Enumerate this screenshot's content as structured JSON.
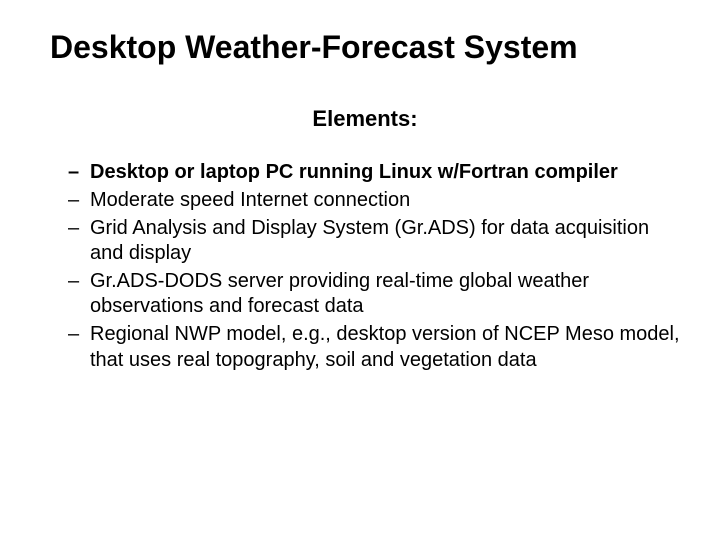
{
  "slide": {
    "title": "Desktop Weather-Forecast System",
    "subtitle": "Elements:",
    "bullets": [
      {
        "text": "Desktop or laptop PC running Linux w/Fortran compiler",
        "bold": true
      },
      {
        "text": "Moderate speed Internet connection",
        "bold": false
      },
      {
        "text": "Grid Analysis and Display System (Gr.ADS) for data acquisition and display",
        "bold": false
      },
      {
        "text": "Gr.ADS-DODS server providing real-time global weather observations and forecast data",
        "bold": false
      },
      {
        "text": "Regional NWP model, e.g., desktop version of NCEP Meso model, that uses real topography, soil and vegetation data",
        "bold": false
      }
    ]
  }
}
